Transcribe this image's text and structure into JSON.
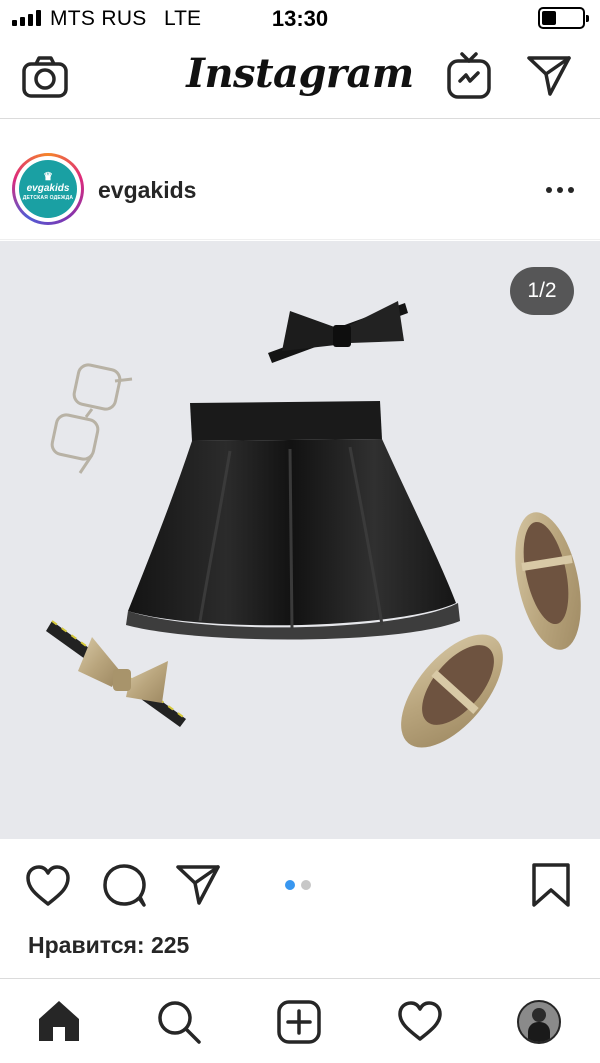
{
  "status_bar": {
    "carrier": "MTS RUS",
    "network": "LTE",
    "time": "13:30",
    "icons": [
      "signal-icon",
      "battery-icon"
    ]
  },
  "top_nav": {
    "brand": "Instagram",
    "icons": [
      "camera-icon",
      "igtv-icon",
      "direct-message-icon"
    ]
  },
  "post": {
    "username": "evgakids",
    "avatar": {
      "word": "evgakids",
      "subtitle": "ДЕТСКАЯ ОДЕЖДА",
      "background": "#1aa0a3"
    },
    "image_counter": "1/2",
    "likes_text": "Нравится: 225",
    "carousel_dots": {
      "total": 2,
      "active": 1,
      "active_color": "#3897f0",
      "inactive_color": "#c7c7c7"
    }
  },
  "actions": {
    "icons": [
      "heart-icon",
      "comment-icon",
      "share-icon",
      "bookmark-icon"
    ]
  },
  "tab_bar": {
    "icons": [
      "home-icon",
      "search-icon",
      "new-post-icon",
      "activity-heart-icon",
      "profile-avatar"
    ]
  }
}
